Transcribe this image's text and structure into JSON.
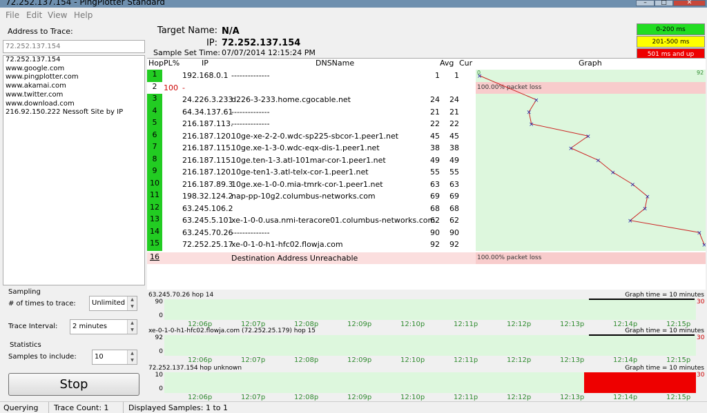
{
  "window": {
    "title": "72.252.137.154 - PingPlotter Standard",
    "controls": [
      "–",
      "□",
      "✕"
    ]
  },
  "menu": [
    "File",
    "Edit",
    "View",
    "Help"
  ],
  "left": {
    "address_label": "Address to Trace:",
    "address_value": "72.252.137.154",
    "history": [
      "72.252.137.154",
      "www.google.com",
      "www.pingplotter.com",
      "www.akamai.com",
      "www.twitter.com",
      "www.download.com",
      "216.92.150.222 Nessoft Site by IP"
    ],
    "sampling_label": "Sampling",
    "times_label": "# of times to trace:",
    "times_value": "Unlimited",
    "interval_label": "Trace Interval:",
    "interval_value": "2 minutes",
    "statistics_label": "Statistics",
    "samples_label": "Samples to include:",
    "samples_value": "10",
    "stop_label": "Stop"
  },
  "header": {
    "target_label": "Target Name:",
    "target_value": "N/A",
    "ip_label": "IP:",
    "ip_value": "72.252.137.154",
    "sample_label": "Sample Set Time:",
    "sample_value": "07/07/2014 12:15:24 PM"
  },
  "legend": [
    {
      "label": "0-200 ms",
      "color": "#22dd22",
      "text": "#000"
    },
    {
      "label": "201-500 ms",
      "color": "#ffff00",
      "text": "#000"
    },
    {
      "label": "501 ms and up",
      "color": "#ee0000",
      "text": "#ffffff"
    }
  ],
  "table": {
    "columns": {
      "hop": "Hop",
      "pl": "PL%",
      "ip": "IP",
      "dns": "DNSName",
      "avg": "Avg",
      "cur": "Cur",
      "graph": "Graph"
    },
    "graph_min": "0",
    "graph_max": "92",
    "rows": [
      {
        "hop": "1",
        "pl": "",
        "ip": "192.168.0.1",
        "dns": "--------------",
        "avg": "1",
        "cur": "1",
        "lat": 1
      },
      {
        "hop": "2",
        "pl": "100",
        "ip": "-",
        "dns": "",
        "avg": "",
        "cur": "",
        "loss": "100.00% packet loss"
      },
      {
        "hop": "3",
        "pl": "",
        "ip": "24.226.3.233",
        "dns": "d226-3-233.home.cgocable.net",
        "avg": "24",
        "cur": "24",
        "lat": 24
      },
      {
        "hop": "4",
        "pl": "",
        "ip": "64.34.137.61",
        "dns": "--------------",
        "avg": "21",
        "cur": "21",
        "lat": 21
      },
      {
        "hop": "5",
        "pl": "",
        "ip": "216.187.113.",
        "dns": "--------------",
        "avg": "22",
        "cur": "22",
        "lat": 22
      },
      {
        "hop": "6",
        "pl": "",
        "ip": "216.187.120.",
        "dns": "10ge-xe-2-2-0.wdc-sp225-sbcor-1.peer1.net",
        "avg": "45",
        "cur": "45",
        "lat": 45
      },
      {
        "hop": "7",
        "pl": "",
        "ip": "216.187.115.",
        "dns": "10ge.xe-1-3-0.wdc-eqx-dis-1.peer1.net",
        "avg": "38",
        "cur": "38",
        "lat": 38
      },
      {
        "hop": "8",
        "pl": "",
        "ip": "216.187.115.",
        "dns": "10ge.ten-1-3.atl-101mar-cor-1.peer1.net",
        "avg": "49",
        "cur": "49",
        "lat": 49
      },
      {
        "hop": "9",
        "pl": "",
        "ip": "216.187.120.",
        "dns": "10ge-ten1-3.atl-telx-cor-1.peer1.net",
        "avg": "55",
        "cur": "55",
        "lat": 55
      },
      {
        "hop": "10",
        "pl": "",
        "ip": "216.187.89.3",
        "dns": "10ge.xe-1-0-0.mia-tmrk-cor-1.peer1.net",
        "avg": "63",
        "cur": "63",
        "lat": 63
      },
      {
        "hop": "11",
        "pl": "",
        "ip": "198.32.124.2",
        "dns": "nap-pp-10g2.columbus-networks.com",
        "avg": "69",
        "cur": "69",
        "lat": 69
      },
      {
        "hop": "12",
        "pl": "",
        "ip": "63.245.106.2",
        "dns": "",
        "avg": "68",
        "cur": "68",
        "lat": 68
      },
      {
        "hop": "13",
        "pl": "",
        "ip": "63.245.5.101",
        "dns": "xe-1-0-0.usa.nmi-teracore01.columbus-networks.com",
        "avg": "62",
        "cur": "62",
        "lat": 62
      },
      {
        "hop": "14",
        "pl": "",
        "ip": "63.245.70.26",
        "dns": "--------------",
        "avg": "90",
        "cur": "90",
        "lat": 90
      },
      {
        "hop": "15",
        "pl": "",
        "ip": "72.252.25.17",
        "dns": "xe-0-1-0-h1-hfc02.flowja.com",
        "avg": "92",
        "cur": "92",
        "lat": 92
      }
    ],
    "final_row": {
      "hop": "16",
      "message": "Destination Address Unreachable",
      "loss": "100.00% packet loss"
    }
  },
  "time_graphs": [
    {
      "title": "63.245.70.26 hop 14",
      "graph_time": "Graph time = 10 minutes",
      "ymax": "90",
      "ymin": "0",
      "redmax": "30",
      "red_fraction": 0
    },
    {
      "title": "xe-0-1-0-h1-hfc02.flowja.com (72.252.25.179) hop 15",
      "graph_time": "Graph time = 10 minutes",
      "ymax": "92",
      "ymin": "0",
      "redmax": "30",
      "red_fraction": 0
    },
    {
      "title": "72.252.137.154 hop unknown",
      "graph_time": "Graph time = 10 minutes",
      "ymax": "10",
      "ymin": "0",
      "redmax": "30",
      "red_fraction": 0.21
    }
  ],
  "time_ticks": [
    "12:06p",
    "12:07p",
    "12:08p",
    "12:09p",
    "12:10p",
    "12:11p",
    "12:12p",
    "12:13p",
    "12:14p",
    "12:15p"
  ],
  "status": {
    "state": "Querying",
    "trace_count": "Trace Count: 1",
    "displayed": "Displayed Samples: 1 to 1"
  },
  "colors": {
    "ok_green": "#22cc22",
    "graph_bg": "#ddf7dd",
    "loss_bg": "#f8cccc",
    "latency_line": "#cc2222",
    "latency_point": "#2222aa"
  }
}
